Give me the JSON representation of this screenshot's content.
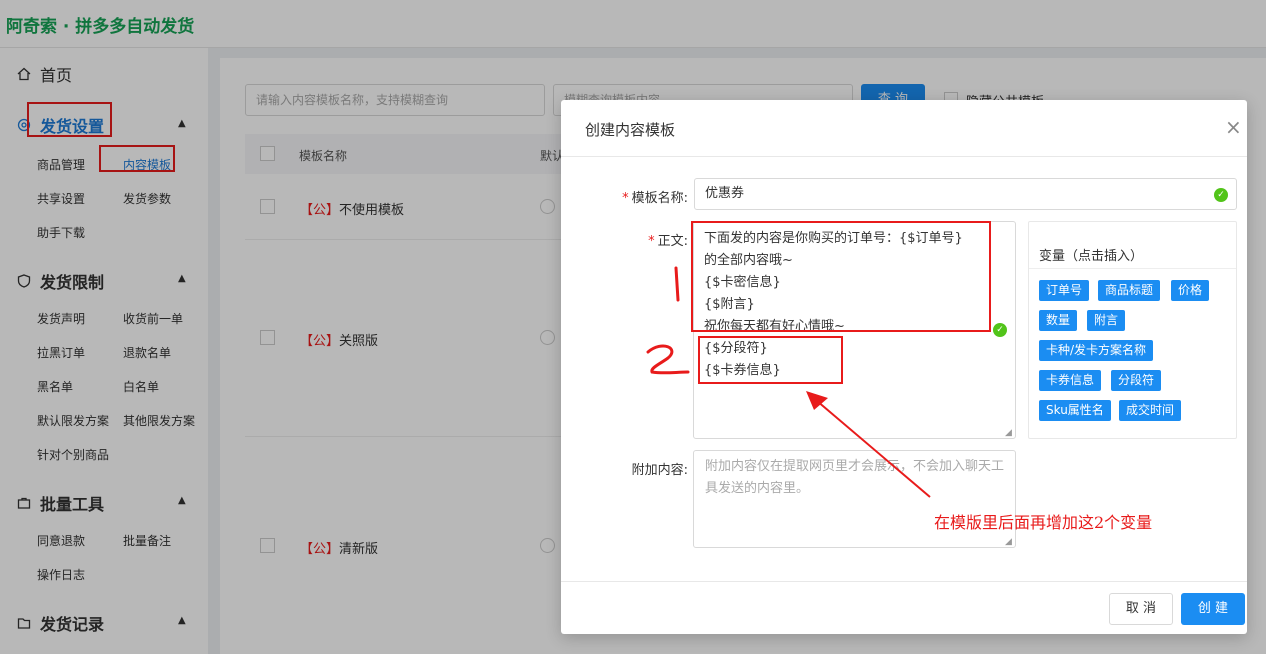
{
  "header": {
    "brand": "阿奇索 · 拼多多自动发货"
  },
  "sidebar": {
    "home": "首页",
    "sections": [
      {
        "title": "发货设置",
        "items": [
          "商品管理",
          "内容模板",
          "共享设置",
          "发货参数",
          "助手下载"
        ]
      },
      {
        "title": "发货限制",
        "items": [
          "发货声明",
          "收货前一单",
          "拉黑订单",
          "退款名单",
          "黑名单",
          "白名单",
          "默认限发方案",
          "其他限发方案",
          "针对个别商品"
        ]
      },
      {
        "title": "批量工具",
        "items": [
          "同意退款",
          "批量备注",
          "操作日志"
        ]
      },
      {
        "title": "发货记录",
        "items": []
      }
    ]
  },
  "main": {
    "search_placeholder": "请输入内容模板名称，支持模糊查询",
    "search_placeholder2": "模糊查询模板内容",
    "search_button": "查 询",
    "hide_public_label": "隐藏公共模板",
    "table": {
      "headers": [
        "模板名称",
        "默认"
      ],
      "rows": [
        {
          "tag": "【公】",
          "name": "不使用模板"
        },
        {
          "tag": "【公】",
          "name": "关照版"
        },
        {
          "tag": "【公】",
          "name": "清新版"
        }
      ]
    }
  },
  "modal": {
    "title": "创建内容模板",
    "close": "×",
    "name_label": "模板名称:",
    "name_value": "优惠券",
    "body_label": "正文:",
    "body_lines": [
      "下面发的内容是你购买的订单号：{$订单号}",
      "的全部内容哦~",
      "{$卡密信息}",
      "{$附言}",
      "祝你每天都有好心情哦~",
      "{$分段符}",
      "{$卡券信息}"
    ],
    "extra_label": "附加内容:",
    "extra_placeholder": "附加内容仅在提取网页里才会展示，不会加入聊天工具发送的内容里。",
    "variables_title": "变量（点击插入）",
    "variables": [
      "订单号",
      "商品标题",
      "价格",
      "数量",
      "附言",
      "卡种/发卡方案名称",
      "卡券信息",
      "分段符",
      "Sku属性名",
      "成交时间"
    ],
    "cancel": "取 消",
    "create": "创 建"
  },
  "annotation": {
    "text": "在模版里后面再增加这2个变量",
    "mark1": "1",
    "mark2": "2"
  },
  "colors": {
    "brand": "#17a356",
    "primary": "#1b8df2",
    "annotation": "#e81b1b",
    "success": "#52c41a"
  }
}
